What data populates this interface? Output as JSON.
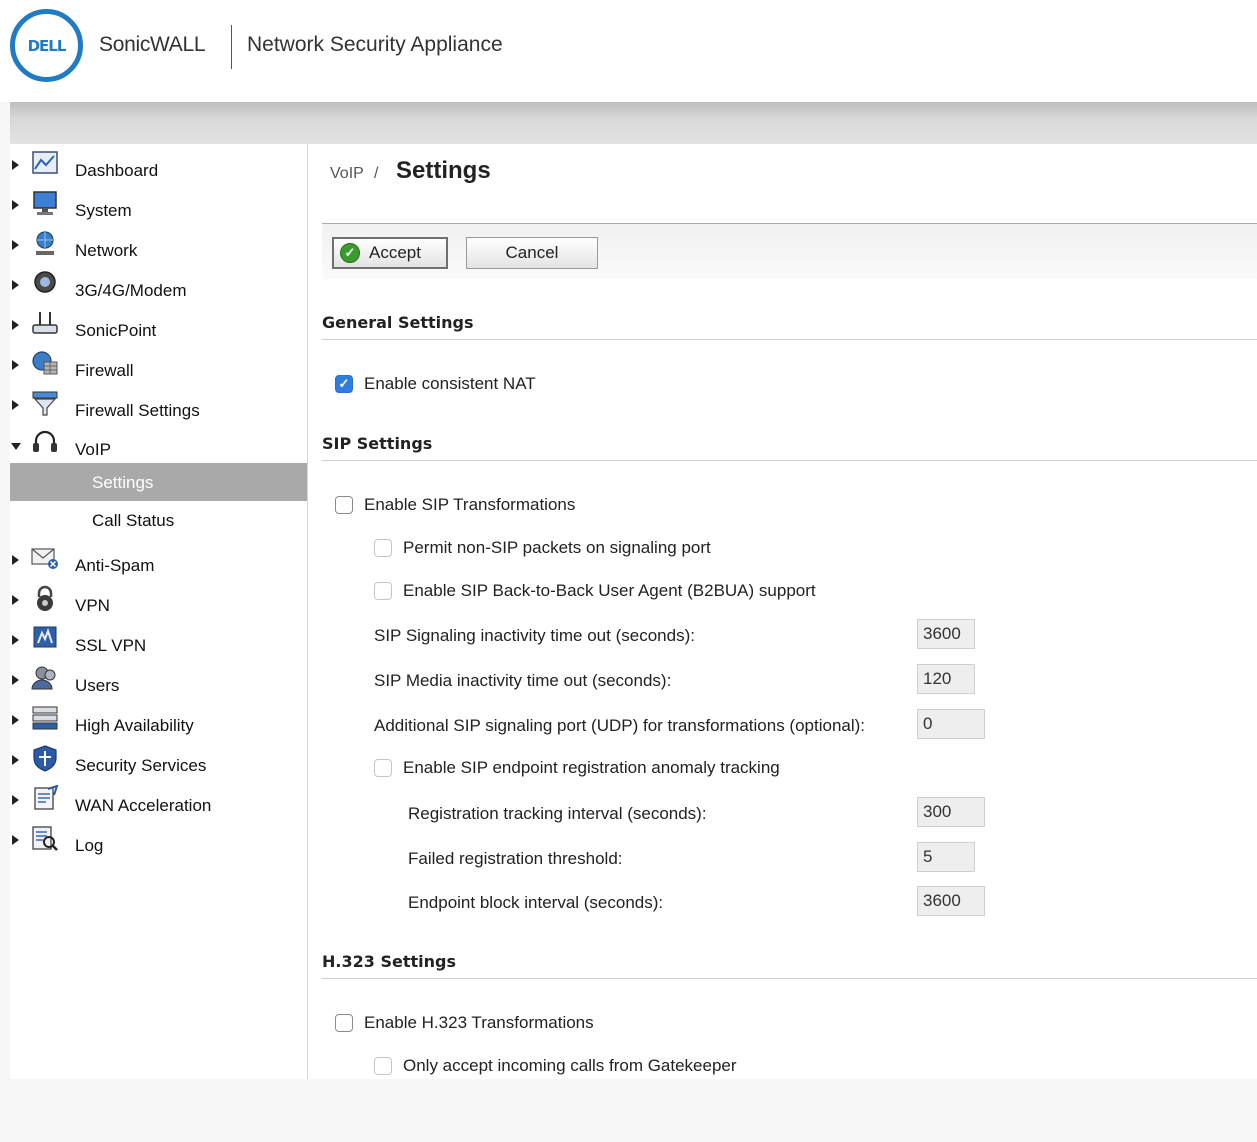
{
  "header": {
    "logo_text": "DELL",
    "brand": "SonicWALL",
    "product": "Network Security Appliance"
  },
  "sidebar": {
    "items": [
      {
        "label": "Dashboard",
        "icon": "dashboard-chart-icon"
      },
      {
        "label": "System",
        "icon": "monitor-icon"
      },
      {
        "label": "Network",
        "icon": "globe-person-icon"
      },
      {
        "label": "3G/4G/Modem",
        "icon": "modem-icon"
      },
      {
        "label": "SonicPoint",
        "icon": "access-point-icon"
      },
      {
        "label": "Firewall",
        "icon": "firewall-globe-icon"
      },
      {
        "label": "Firewall Settings",
        "icon": "funnel-icon"
      },
      {
        "label": "VoIP",
        "icon": "headset-icon",
        "expanded": true
      },
      {
        "label": "Anti-Spam",
        "icon": "mail-block-icon"
      },
      {
        "label": "VPN",
        "icon": "lock-icon"
      },
      {
        "label": "SSL VPN",
        "icon": "ssl-vpn-icon"
      },
      {
        "label": "Users",
        "icon": "users-icon"
      },
      {
        "label": "High Availability",
        "icon": "server-stack-icon"
      },
      {
        "label": "Security Services",
        "icon": "shield-icon"
      },
      {
        "label": "WAN Acceleration",
        "icon": "wan-document-icon"
      },
      {
        "label": "Log",
        "icon": "log-magnifier-icon"
      }
    ],
    "voip_sub": [
      {
        "label": "Settings",
        "active": true
      },
      {
        "label": "Call Status",
        "active": false
      }
    ]
  },
  "breadcrumb": {
    "parent": "VoIP",
    "separator": "/",
    "title": "Settings"
  },
  "actions": {
    "accept": "Accept",
    "cancel": "Cancel"
  },
  "general": {
    "title": "General Settings",
    "consistent_nat": {
      "label": "Enable consistent NAT",
      "checked": true
    }
  },
  "sip": {
    "title": "SIP Settings",
    "enable_transform": {
      "label": "Enable SIP Transformations",
      "checked": false
    },
    "permit_non_sip": {
      "label": "Permit non-SIP packets on signaling port",
      "checked": false
    },
    "b2bua": {
      "label": "Enable SIP Back-to-Back User Agent (B2BUA) support",
      "checked": false
    },
    "signaling_timeout": {
      "label": "SIP Signaling inactivity time out (seconds):",
      "value": "3600"
    },
    "media_timeout": {
      "label": "SIP Media inactivity time out (seconds):",
      "value": "120"
    },
    "extra_port": {
      "label": "Additional SIP signaling port (UDP) for transformations (optional):",
      "value": "0"
    },
    "anomaly_tracking": {
      "label": "Enable SIP endpoint registration anomaly tracking",
      "checked": false
    },
    "tracking_interval": {
      "label": "Registration tracking interval (seconds):",
      "value": "300"
    },
    "failed_threshold": {
      "label": "Failed registration threshold:",
      "value": "5"
    },
    "block_interval": {
      "label": "Endpoint block interval (seconds):",
      "value": "3600"
    }
  },
  "h323": {
    "title": "H.323 Settings",
    "enable_transform": {
      "label": "Enable H.323 Transformations",
      "checked": false
    },
    "gatekeeper_only": {
      "label": "Only accept incoming calls from Gatekeeper",
      "checked": false
    }
  },
  "colors": {
    "brand_blue": "#1f7bc4",
    "checkbox_blue": "#2f7de1",
    "active_nav": "#a9a9a9",
    "ok_green": "#3a9b2e"
  }
}
